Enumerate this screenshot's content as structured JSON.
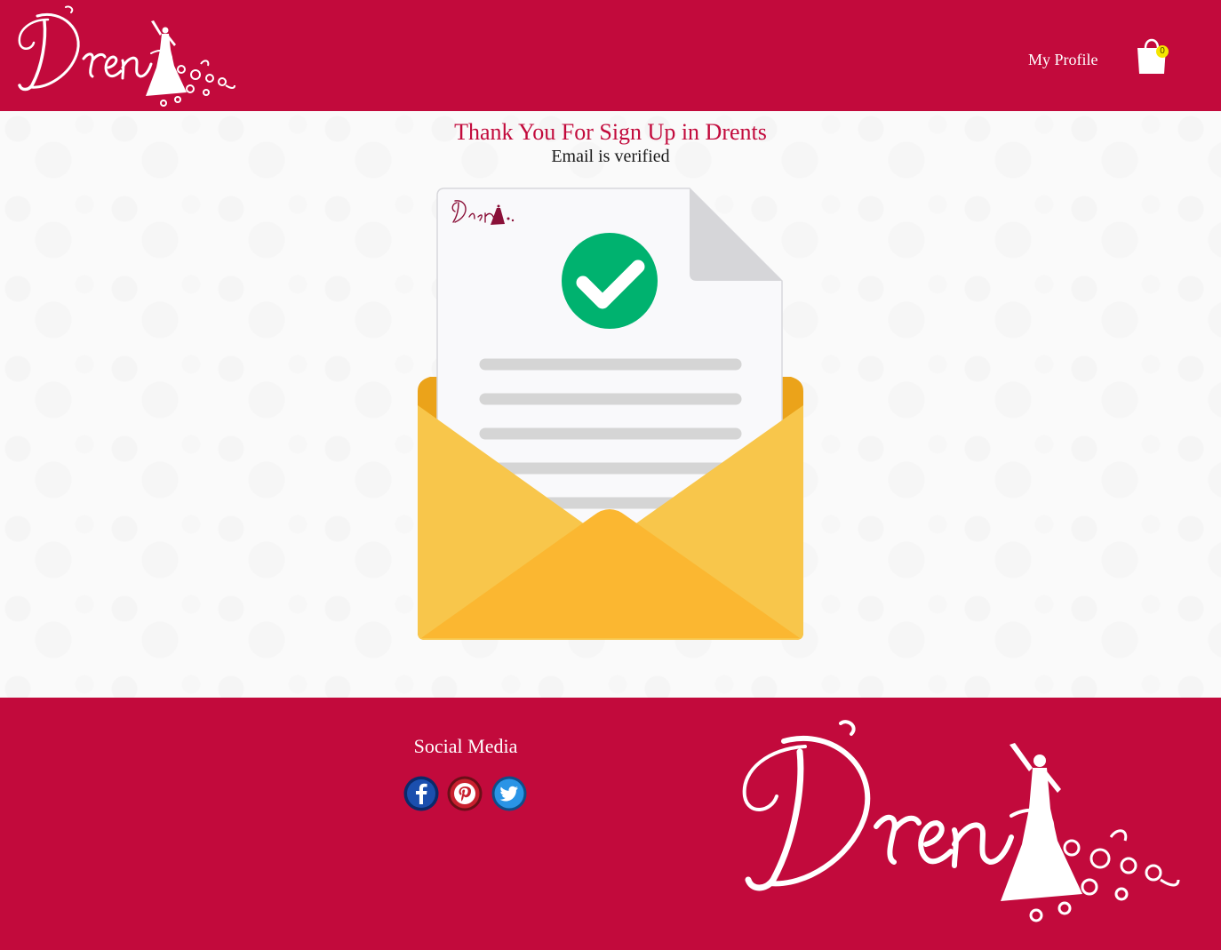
{
  "header": {
    "brand": "Drents",
    "nav": {
      "profile_label": "My Profile"
    },
    "cart": {
      "count": "0"
    }
  },
  "main": {
    "title": "Thank You For Sign Up in Drents",
    "subtitle": "Email is verified"
  },
  "footer": {
    "social_title": "Social Media",
    "social": [
      {
        "name": "facebook-icon"
      },
      {
        "name": "pinterest-icon"
      },
      {
        "name": "twitter-icon"
      }
    ]
  },
  "colors": {
    "brand": "#c20a3c",
    "check": "#00b26f",
    "envelope": "#f8c64b"
  }
}
